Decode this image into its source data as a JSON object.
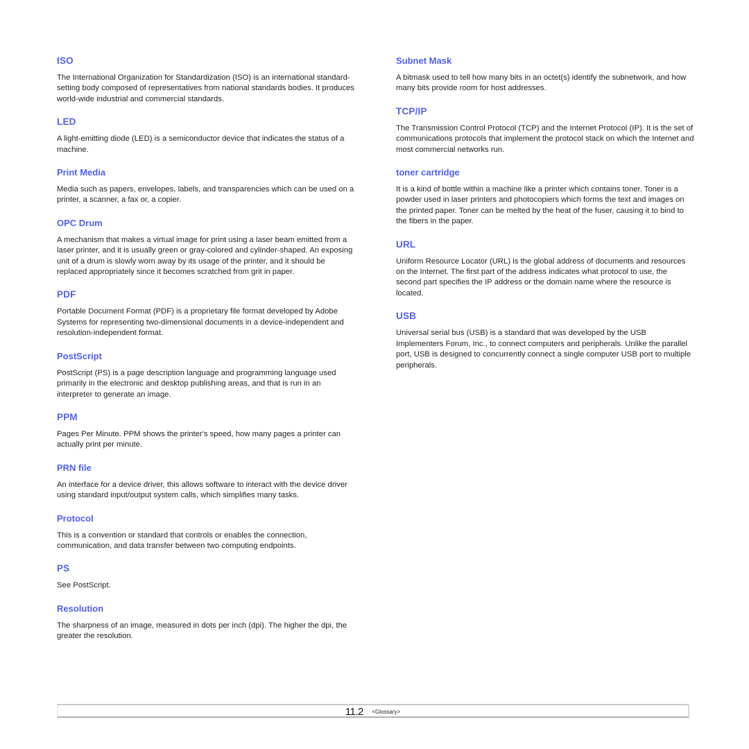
{
  "theme": {
    "heading_color": "#4f5ff0"
  },
  "left_column": [
    {
      "term": "ISO",
      "definition": "The International Organization for Standardization (ISO) is an international standard-setting body composed of representatives from national standards bodies. It produces world-wide industrial and commercial standards."
    },
    {
      "term": "LED",
      "definition": "A light-emitting diode (LED) is a semiconductor device that indicates the status of a machine."
    },
    {
      "term": "Print Media",
      "definition": "Media such as papers, envelopes, labels, and transparencies which can be used on a printer, a scanner, a fax or, a copier."
    },
    {
      "term": "OPC Drum",
      "definition": "A mechanism that makes a virtual image for print using a laser beam emitted from a laser printer, and it is usually green or gray-colored and cylinder-shaped. An exposing unit of a drum is slowly worn away by its usage of the printer, and it should be replaced appropriately since it becomes scratched from grit in paper."
    },
    {
      "term": "PDF",
      "definition": "Portable Document Format (PDF) is a proprietary file format developed by Adobe Systems for representing two-dimensional documents in a device-independent and resolution-independent format."
    },
    {
      "term": "PostScript",
      "definition": "PostScript (PS) is a page description language and programming language used primarily in the electronic and desktop publishing areas, and that is run in an interpreter to generate an image."
    },
    {
      "term": "PPM",
      "definition": "Pages Per Minute. PPM shows the printer's speed, how many pages a printer can actually print per minute."
    },
    {
      "term": "PRN file",
      "definition": "An interface for a device driver, this allows software to interact with the device driver using standard input/output system calls, which simplifies many tasks."
    },
    {
      "term": "Protocol",
      "definition": "This is a convention or standard that controls or enables the connection, communication, and data transfer between two computing endpoints."
    },
    {
      "term": "PS",
      "definition": "See PostScript."
    },
    {
      "term": "Resolution",
      "definition": "The sharpness of an image, measured in dots per inch (dpi). The higher the dpi, the greater the resolution."
    }
  ],
  "right_column": [
    {
      "term": "Subnet Mask",
      "definition": "A bitmask used to tell how many bits in an octet(s) identify the subnetwork, and how many bits provide room for host addresses."
    },
    {
      "term": "TCP/IP",
      "definition": "The Transmission Control Protocol (TCP) and the Internet Protocol (IP). It is the set of communications protocols that implement the protocol stack on which the Internet and most commercial networks run."
    },
    {
      "term": "toner cartridge",
      "definition": "It is a kind of bottle within a machine like a printer which contains toner. Toner is a powder used in laser printers and photocopiers which forms the text and images on the printed paper. Toner can be melted by the heat of the fuser, causing it to bind to the fibers in the paper."
    },
    {
      "term": "URL",
      "definition": "Uniform Resource Locator (URL) is the global address of documents and resources on the Internet. The first part of the address indicates what protocol to use, the second part specifies the IP address or the domain name where the resource is located."
    },
    {
      "term": "USB",
      "definition": "Universal serial bus (USB) is a standard that was developed by the USB Implementers Forum, Inc., to connect computers and peripherals. Unlike the parallel port, USB is designed to concurrently connect a single computer USB port to multiple peripherals."
    }
  ],
  "footer": {
    "page_number": "11.2",
    "chapter": "<Glossary>"
  }
}
